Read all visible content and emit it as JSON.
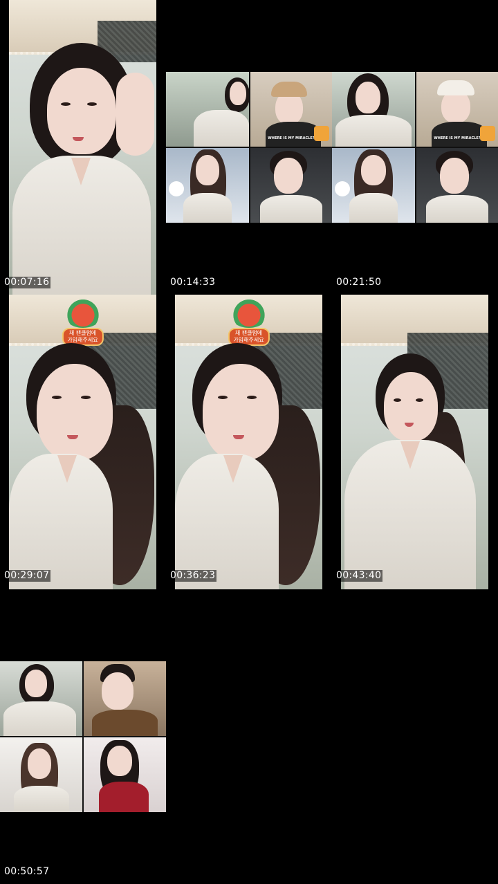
{
  "thumbnails": [
    {
      "timestamp": "00:07:16"
    },
    {
      "timestamp": "00:14:33",
      "caption_left": "WHERE IS MY MIRACLE?",
      "caption_right": "WHERE IS MY MIRACLE?"
    },
    {
      "timestamp": "00:21:50"
    },
    {
      "timestamp": "00:29:07",
      "badge_text": "채 팬클럽에\n가입해주세요"
    },
    {
      "timestamp": "00:36:23",
      "badge_text": "채 팬클럽에\n가입해주세요"
    },
    {
      "timestamp": "00:43:40"
    },
    {
      "timestamp": "00:50:57"
    }
  ],
  "colors": {
    "background": "#000000",
    "timestamp_text": "#ffffff",
    "badge_fill": "#d9532a",
    "badge_border": "#f3c66b"
  }
}
